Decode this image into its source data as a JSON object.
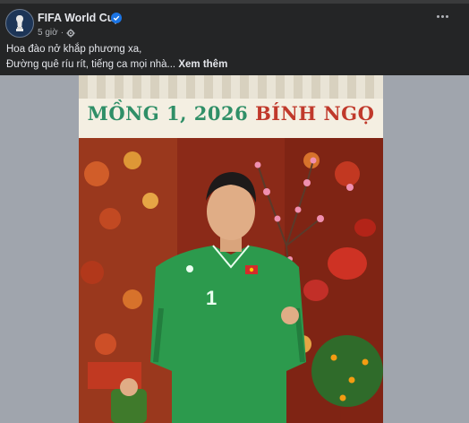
{
  "post": {
    "page_name": "FIFA World Cup",
    "timestamp": "5 giờ",
    "separator": "·",
    "caption_line1": "Hoa đào nở khắp phương xa,",
    "caption_line2": "Đường quê ríu rít, tiếng ca mọi nhà...",
    "see_more": "Xem thêm"
  },
  "photo": {
    "banner_prefix": "MỒNG 1, 2026",
    "banner_suffix": "BÍNH NGỌ",
    "jersey_number": "1"
  },
  "icons": {
    "verified": "verified-badge-icon",
    "audience": "globe-settings-icon",
    "more": "more-options-icon"
  },
  "colors": {
    "background": "#242526",
    "text_primary": "#e4e6eb",
    "text_secondary": "#b0b3b8",
    "verified_blue": "#1b74e4",
    "jersey_green": "#2c9a4d",
    "banner_green": "#2f8f67",
    "banner_red": "#c0392b"
  }
}
